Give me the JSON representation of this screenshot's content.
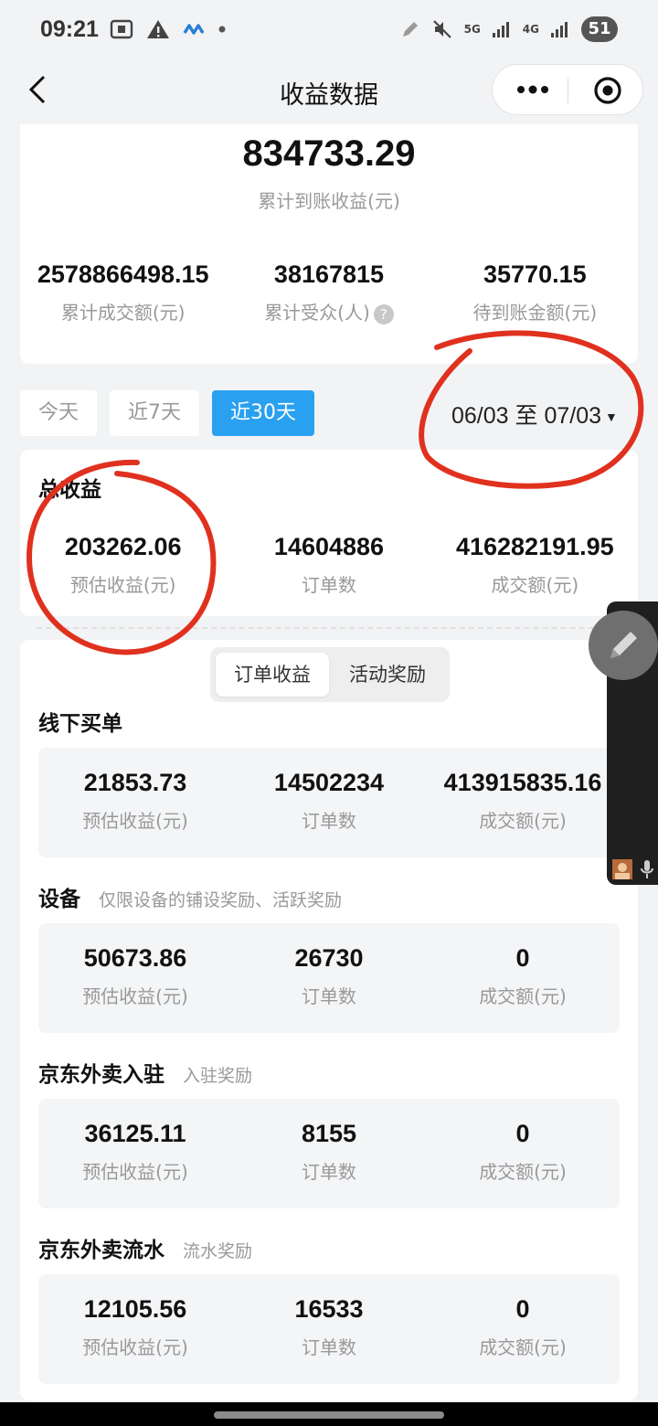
{
  "status_bar": {
    "time": "09:21",
    "network_5g": "5G",
    "network_4g": "4G",
    "battery": "51"
  },
  "nav": {
    "title": "收益数据"
  },
  "summary": {
    "settled_income": "834733.29",
    "settled_income_label": "累计到账收益(元)",
    "stats": [
      {
        "value": "2578866498.15",
        "label": "累计成交额(元)"
      },
      {
        "value": "38167815",
        "label": "累计受众(人)"
      },
      {
        "value": "35770.15",
        "label": "待到账金额(元)"
      }
    ]
  },
  "filters": {
    "tabs": [
      "今天",
      "近7天",
      "近30天"
    ],
    "active_tab": "近30天",
    "date_range": "06/03 至 07/03"
  },
  "total": {
    "title": "总收益",
    "stats": [
      {
        "value": "203262.06",
        "label": "预估收益(元)"
      },
      {
        "value": "14604886",
        "label": "订单数"
      },
      {
        "value": "416282191.95",
        "label": "成交额(元)"
      }
    ]
  },
  "segment": {
    "options": [
      "订单收益",
      "活动奖励"
    ],
    "active": "订单收益"
  },
  "sections": [
    {
      "title": "线下买单",
      "subtitle": "",
      "stats": [
        {
          "value": "21853.73",
          "label": "预估收益(元)"
        },
        {
          "value": "14502234",
          "label": "订单数"
        },
        {
          "value": "413915835.16",
          "label": "成交额(元)"
        }
      ]
    },
    {
      "title": "设备",
      "subtitle": "仅限设备的铺设奖励、活跃奖励",
      "stats": [
        {
          "value": "50673.86",
          "label": "预估收益(元)"
        },
        {
          "value": "26730",
          "label": "订单数"
        },
        {
          "value": "0",
          "label": "成交额(元)"
        }
      ]
    },
    {
      "title": "京东外卖入驻",
      "subtitle": "入驻奖励",
      "stats": [
        {
          "value": "36125.11",
          "label": "预估收益(元)"
        },
        {
          "value": "8155",
          "label": "订单数"
        },
        {
          "value": "0",
          "label": "成交额(元)"
        }
      ]
    },
    {
      "title": "京东外卖流水",
      "subtitle": "流水奖励",
      "stats": [
        {
          "value": "12105.56",
          "label": "预估收益(元)"
        },
        {
          "value": "16533",
          "label": "订单数"
        },
        {
          "value": "0",
          "label": "成交额(元)"
        }
      ]
    }
  ],
  "colors": {
    "accent": "#2aa0f0",
    "annotation_ring": "#e0311f",
    "page_bg": "#f2f3f5"
  }
}
